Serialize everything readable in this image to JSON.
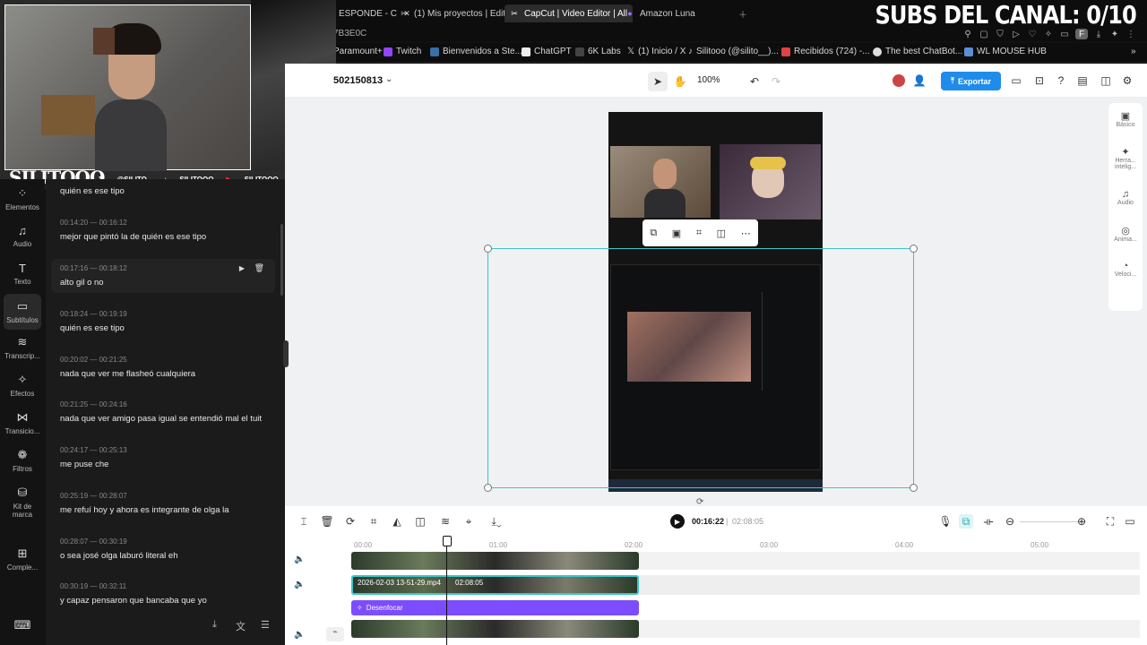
{
  "browser": {
    "tabs": [
      {
        "label": "ESPONDE - C"
      },
      {
        "label": "(1)  Mis proyectos | Edito"
      },
      {
        "label": "CapCut | Video Editor | All"
      },
      {
        "label": "Amazon Luna"
      }
    ],
    "url_fragment": "7B3E0C",
    "bookmarks": [
      {
        "label": "Paramount+"
      },
      {
        "label": "Twitch"
      },
      {
        "label": "Bienvenidos a Ste..."
      },
      {
        "label": "ChatGPT"
      },
      {
        "label": "6K Labs"
      },
      {
        "label": "(1) Inicio / X"
      },
      {
        "label": "Silitooo (@silito__)..."
      },
      {
        "label": "Recibidos (724) -..."
      },
      {
        "label": "The best ChatBot..."
      },
      {
        "label": "WL MOUSE HUB"
      }
    ],
    "avatar_letter": "F"
  },
  "overlay": {
    "subs_counter": "SUBS DEL CANAL: 0/10",
    "streamer_name": "SILITOOO",
    "socials": [
      "@SILITO_",
      "SILITOOO",
      "SILITOOO"
    ]
  },
  "editor": {
    "project_id": "502150813",
    "zoom": "100%",
    "export_label": "Exportar",
    "current_time": "00:16:22",
    "total_time": "02:08:05"
  },
  "sidebar": {
    "items": [
      {
        "label": "Elementos"
      },
      {
        "label": "Audio"
      },
      {
        "label": "Texto"
      },
      {
        "label": "Subtítulos"
      },
      {
        "label": "Transcrip..."
      },
      {
        "label": "Efectos"
      },
      {
        "label": "Transicio..."
      },
      {
        "label": "Filtros"
      },
      {
        "label": "Kit de marca"
      },
      {
        "label": "Comple..."
      }
    ]
  },
  "subtitles": [
    {
      "time": "",
      "text": "quién es ese tipo"
    },
    {
      "time": "00:14:20 — 00:16:12",
      "text": "mejor que pintó la de quién es ese tipo"
    },
    {
      "time": "00:17:16 — 00:18:12",
      "text": "alto gil o no"
    },
    {
      "time": "00:18:24 — 00:19:19",
      "text": "quién es ese tipo"
    },
    {
      "time": "00:20:02 — 00:21:25",
      "text": "nada que ver me flasheó cualquiera"
    },
    {
      "time": "00:21:25 — 00:24:16",
      "text": "nada que ver amigo pasa igual se entendió mal el tuit"
    },
    {
      "time": "00:24:17 — 00:25:13",
      "text": "me puse che"
    },
    {
      "time": "00:25:19 — 00:28:07",
      "text": "me refuí hoy y ahora es integrante de olga la"
    },
    {
      "time": "00:28:07 — 00:30:19",
      "text": "o sea josé olga laburó literal eh"
    },
    {
      "time": "00:30:19 — 00:32:11",
      "text": "y capaz pensaron que bancaba que yo"
    }
  ],
  "rightpanel": {
    "items": [
      {
        "label": "Básico"
      },
      {
        "label": "Herra... intelig..."
      },
      {
        "label": "Audio"
      },
      {
        "label": "Anima..."
      },
      {
        "label": "Veloci..."
      }
    ]
  },
  "timeline": {
    "ruler": [
      "00:00",
      "01:00",
      "02:00",
      "03:00",
      "04:00",
      "05:00"
    ],
    "clip_label": "2026-02-03 13-51-29.mp4",
    "clip_duration": "02:08:05",
    "effect_label": "Desenfocar",
    "playhead_fraction": 0.128
  },
  "colors": {
    "accent": "#1f8ceb",
    "effect": "#7c4dff",
    "selection": "#3cc6c6"
  }
}
